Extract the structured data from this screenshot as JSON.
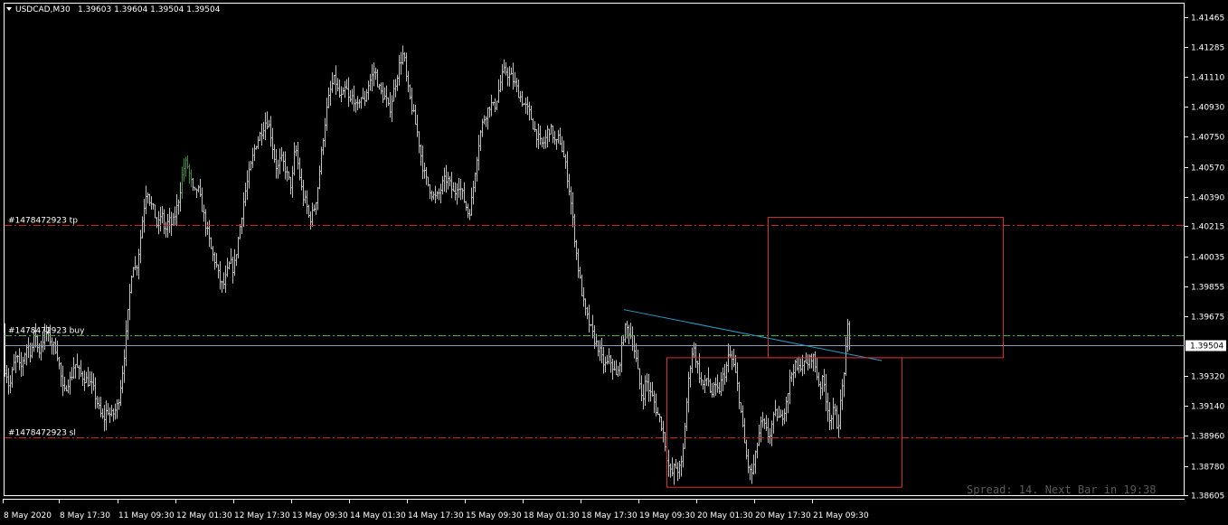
{
  "header": {
    "symbol_timeframe": "USDCAD,M30",
    "ohlc": "1.39603 1.39604 1.39504 1.39504"
  },
  "status": {
    "spread_text": "Spread: 14. Next Bar in 19:38"
  },
  "colors": {
    "background": "#000000",
    "frame": "#ffffff",
    "bars": "#bfbfbf",
    "bars_highlight": "#3a8a3a",
    "tp_sl_line": "#d42020",
    "entry_line": "#3cb43c",
    "bid_line": "#8a9ab0",
    "trend_line": "#2c9ccc",
    "rect": "#d03030"
  },
  "chart_data": {
    "type": "bar",
    "subtype": "ohlc",
    "symbol": "USDCAD",
    "timeframe": "M30",
    "ylim": [
      1.3856,
      1.4155
    ],
    "y_ticks": [
      "1.41465",
      "1.41285",
      "1.41110",
      "1.40930",
      "1.40750",
      "1.40570",
      "1.40390",
      "1.40215",
      "1.40035",
      "1.39855",
      "1.39675",
      "1.39320",
      "1.39140",
      "1.38960",
      "1.38780",
      "1.38605"
    ],
    "current_price": "1.39504",
    "x_labels": [
      "8 May 2020",
      "8 May 17:30",
      "11 May 09:30",
      "12 May 01:30",
      "12 May 17:30",
      "13 May 09:30",
      "14 May 01:30",
      "14 May 17:30",
      "15 May 09:30",
      "18 May 01:30",
      "18 May 17:30",
      "19 May 09:30",
      "20 May 01:30",
      "20 May 17:30",
      "21 May 09:30"
    ],
    "anchors": [
      [
        0,
        1.3957
      ],
      [
        3,
        1.3937
      ],
      [
        6,
        1.3936
      ],
      [
        10,
        1.3924
      ],
      [
        14,
        1.3937
      ],
      [
        18,
        1.3944
      ],
      [
        22,
        1.3935
      ],
      [
        26,
        1.3944
      ],
      [
        30,
        1.3951
      ],
      [
        34,
        1.3945
      ],
      [
        38,
        1.396
      ],
      [
        42,
        1.3945
      ],
      [
        46,
        1.3952
      ],
      [
        50,
        1.3958
      ],
      [
        54,
        1.3955
      ],
      [
        58,
        1.395
      ],
      [
        62,
        1.3948
      ],
      [
        66,
        1.3935
      ],
      [
        70,
        1.392
      ],
      [
        74,
        1.3928
      ],
      [
        78,
        1.393
      ],
      [
        82,
        1.394
      ],
      [
        86,
        1.3935
      ],
      [
        90,
        1.3932
      ],
      [
        94,
        1.393
      ],
      [
        98,
        1.3928
      ],
      [
        102,
        1.3925
      ],
      [
        106,
        1.3918
      ],
      [
        110,
        1.391
      ],
      [
        114,
        1.3905
      ],
      [
        118,
        1.3912
      ],
      [
        122,
        1.3908
      ],
      [
        126,
        1.391
      ],
      [
        130,
        1.3915
      ],
      [
        134,
        1.393
      ],
      [
        138,
        1.395
      ],
      [
        142,
        1.3975
      ],
      [
        146,
        1.4
      ],
      [
        150,
        1.3995
      ],
      [
        154,
        1.401
      ],
      [
        158,
        1.403
      ],
      [
        162,
        1.4045
      ],
      [
        166,
        1.4035
      ],
      [
        170,
        1.403
      ],
      [
        174,
        1.402
      ],
      [
        178,
        1.403
      ],
      [
        182,
        1.4018
      ],
      [
        186,
        1.4025
      ],
      [
        190,
        1.4022
      ],
      [
        194,
        1.403
      ],
      [
        198,
        1.404
      ],
      [
        202,
        1.4055
      ],
      [
        206,
        1.406
      ],
      [
        210,
        1.405
      ],
      [
        214,
        1.404
      ],
      [
        218,
        1.4045
      ],
      [
        222,
        1.4035
      ],
      [
        226,
        1.4025
      ],
      [
        230,
        1.4015
      ],
      [
        234,
        1.4005
      ],
      [
        238,
        1.4
      ],
      [
        242,
        1.399
      ],
      [
        246,
        1.3985
      ],
      [
        250,
        1.3992
      ],
      [
        254,
        1.4
      ],
      [
        258,
        1.3995
      ],
      [
        262,
        1.401
      ],
      [
        266,
        1.4025
      ],
      [
        270,
        1.404
      ],
      [
        274,
        1.405
      ],
      [
        278,
        1.406
      ],
      [
        282,
        1.407
      ],
      [
        286,
        1.4075
      ],
      [
        290,
        1.408
      ],
      [
        294,
        1.4085
      ],
      [
        298,
        1.408
      ],
      [
        302,
        1.4065
      ],
      [
        306,
        1.4055
      ],
      [
        310,
        1.4062
      ],
      [
        314,
        1.4058
      ],
      [
        318,
        1.405
      ],
      [
        322,
        1.4045
      ],
      [
        326,
        1.407
      ],
      [
        330,
        1.4055
      ],
      [
        334,
        1.404
      ],
      [
        338,
        1.4035
      ],
      [
        342,
        1.4025
      ],
      [
        346,
        1.403
      ],
      [
        350,
        1.404
      ],
      [
        354,
        1.406
      ],
      [
        358,
        1.408
      ],
      [
        362,
        1.4095
      ],
      [
        366,
        1.4105
      ],
      [
        370,
        1.411
      ],
      [
        374,
        1.41
      ],
      [
        378,
        1.4098
      ],
      [
        382,
        1.4105
      ],
      [
        386,
        1.4095
      ],
      [
        390,
        1.41
      ],
      [
        394,
        1.409
      ],
      [
        398,
        1.41
      ],
      [
        402,
        1.4095
      ],
      [
        406,
        1.4105
      ],
      [
        410,
        1.411
      ],
      [
        414,
        1.4115
      ],
      [
        418,
        1.4105
      ],
      [
        422,
        1.41
      ],
      [
        426,
        1.4098
      ],
      [
        430,
        1.409
      ],
      [
        434,
        1.41
      ],
      [
        438,
        1.411
      ],
      [
        442,
        1.412
      ],
      [
        446,
        1.4125
      ],
      [
        450,
        1.4105
      ],
      [
        454,
        1.4095
      ],
      [
        458,
        1.4085
      ],
      [
        462,
        1.4075
      ],
      [
        466,
        1.406
      ],
      [
        470,
        1.405
      ],
      [
        474,
        1.4045
      ],
      [
        478,
        1.404
      ],
      [
        482,
        1.4038
      ],
      [
        486,
        1.4042
      ],
      [
        490,
        1.4048
      ],
      [
        494,
        1.405
      ],
      [
        498,
        1.4045
      ],
      [
        502,
        1.404
      ],
      [
        506,
        1.4048
      ],
      [
        510,
        1.4042
      ],
      [
        514,
        1.4035
      ],
      [
        518,
        1.4028
      ],
      [
        522,
        1.404
      ],
      [
        526,
        1.406
      ],
      [
        530,
        1.4075
      ],
      [
        534,
        1.4085
      ],
      [
        538,
        1.409
      ],
      [
        542,
        1.4095
      ],
      [
        546,
        1.4092
      ],
      [
        550,
        1.41
      ],
      [
        554,
        1.411
      ],
      [
        558,
        1.4115
      ],
      [
        562,
        1.4112
      ],
      [
        566,
        1.411
      ],
      [
        570,
        1.4105
      ],
      [
        574,
        1.41
      ],
      [
        578,
        1.4095
      ],
      [
        582,
        1.4092
      ],
      [
        586,
        1.4088
      ],
      [
        590,
        1.408
      ],
      [
        594,
        1.4075
      ],
      [
        598,
        1.407
      ],
      [
        602,
        1.4072
      ],
      [
        606,
        1.408
      ],
      [
        610,
        1.4078
      ],
      [
        614,
        1.407
      ],
      [
        618,
        1.4075
      ],
      [
        622,
        1.4065
      ],
      [
        626,
        1.4055
      ],
      [
        630,
        1.404
      ],
      [
        634,
        1.402
      ],
      [
        638,
        1.4
      ],
      [
        642,
        1.3985
      ],
      [
        646,
        1.3972
      ],
      [
        650,
        1.3965
      ],
      [
        654,
        1.3958
      ],
      [
        658,
        1.3952
      ],
      [
        662,
        1.3948
      ],
      [
        666,
        1.394
      ],
      [
        670,
        1.3938
      ],
      [
        674,
        1.3942
      ],
      [
        678,
        1.3936
      ],
      [
        682,
        1.393
      ],
      [
        686,
        1.3945
      ],
      [
        690,
        1.396
      ],
      [
        694,
        1.396
      ],
      [
        698,
        1.3955
      ],
      [
        702,
        1.3945
      ],
      [
        706,
        1.393
      ],
      [
        710,
        1.3918
      ],
      [
        714,
        1.393
      ],
      [
        718,
        1.3922
      ],
      [
        722,
        1.3918
      ],
      [
        726,
        1.391
      ],
      [
        730,
        1.3905
      ],
      [
        734,
        1.3895
      ],
      [
        738,
        1.388
      ],
      [
        742,
        1.3872
      ],
      [
        746,
        1.3878
      ],
      [
        750,
        1.3875
      ],
      [
        754,
        1.388
      ],
      [
        758,
        1.391
      ],
      [
        762,
        1.3935
      ],
      [
        766,
        1.395
      ],
      [
        770,
        1.394
      ],
      [
        774,
        1.393
      ],
      [
        778,
        1.3925
      ],
      [
        782,
        1.3932
      ],
      [
        786,
        1.392
      ],
      [
        790,
        1.3925
      ],
      [
        794,
        1.3922
      ],
      [
        798,
        1.393
      ],
      [
        802,
        1.3935
      ],
      [
        806,
        1.3945
      ],
      [
        810,
        1.394
      ],
      [
        814,
        1.393
      ],
      [
        818,
        1.3915
      ],
      [
        822,
        1.3895
      ],
      [
        826,
        1.388
      ],
      [
        830,
        1.3872
      ],
      [
        834,
        1.388
      ],
      [
        838,
        1.3895
      ],
      [
        842,
        1.3905
      ],
      [
        846,
        1.39
      ],
      [
        850,
        1.3895
      ],
      [
        854,
        1.3905
      ],
      [
        858,
        1.391
      ],
      [
        862,
        1.3905
      ],
      [
        866,
        1.391
      ],
      [
        870,
        1.392
      ],
      [
        874,
        1.3932
      ],
      [
        878,
        1.3938
      ],
      [
        882,
        1.3935
      ],
      [
        886,
        1.394
      ],
      [
        890,
        1.3938
      ],
      [
        894,
        1.394
      ],
      [
        898,
        1.3945
      ],
      [
        902,
        1.3935
      ],
      [
        906,
        1.3925
      ],
      [
        910,
        1.393
      ],
      [
        914,
        1.3915
      ],
      [
        918,
        1.3905
      ],
      [
        922,
        1.3912
      ],
      [
        926,
        1.39
      ],
      [
        930,
        1.392
      ],
      [
        934,
        1.394
      ],
      [
        937,
        1.396
      ],
      [
        940,
        1.395
      ]
    ],
    "levels": [
      {
        "label": "#1478472923 tp",
        "price": 1.4022,
        "kind": "tp"
      },
      {
        "label": "#1478472923 buy",
        "price": 1.39563,
        "kind": "entry"
      },
      {
        "label": "#1478472923 sl",
        "price": 1.3895,
        "kind": "sl"
      }
    ],
    "trend_line": {
      "x1_bar": 690,
      "y1": 1.39715,
      "x2_bar": 975,
      "y2": 1.3941
    },
    "rectangles": [
      {
        "x1_bar": 849,
        "y1": 1.4027,
        "x2_bar": 1109,
        "y2": 1.3943
      },
      {
        "x1_bar": 737,
        "y1": 1.3943,
        "x2_bar": 997,
        "y2": 1.38655
      }
    ]
  }
}
